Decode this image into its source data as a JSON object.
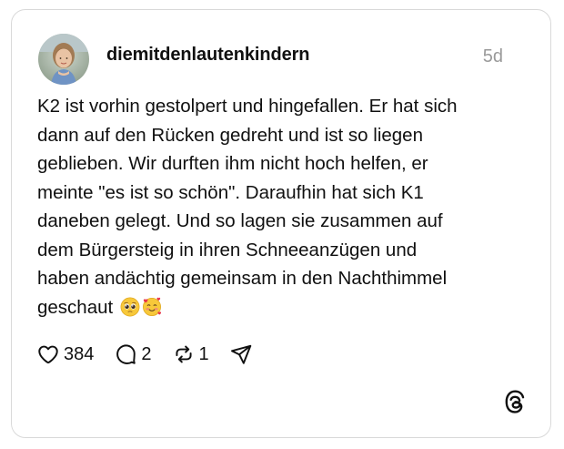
{
  "post": {
    "username": "diemitdenlautenkindern",
    "timestamp": "5d",
    "text_lines": [
      "K2 ist vorhin gestolpert und hingefallen. Er hat sich",
      "dann auf den Rücken gedreht und ist so liegen",
      "geblieben. Wir durften ihm nicht hoch helfen, er",
      "meinte \"es ist so schön\". Daraufhin hat sich K1",
      "daneben gelegt. Und so lagen sie zusammen auf",
      "dem Bürgersteig in ihren Schneeanzügen und",
      "haben andächtig gemeinsam in den Nachthimmel",
      "geschaut"
    ],
    "emojis": [
      "pleading-face-icon",
      "smiling-face-with-hearts-icon"
    ]
  },
  "actions": {
    "like": {
      "icon": "heart-icon",
      "count": "384"
    },
    "reply": {
      "icon": "comment-icon",
      "count": "2"
    },
    "repost": {
      "icon": "repost-icon",
      "count": "1"
    },
    "share": {
      "icon": "send-icon"
    }
  },
  "branding": {
    "logo": "threads-logo-icon"
  },
  "colors": {
    "text": "#101010",
    "muted": "#9a9a9a",
    "border": "#d9d9d9"
  }
}
